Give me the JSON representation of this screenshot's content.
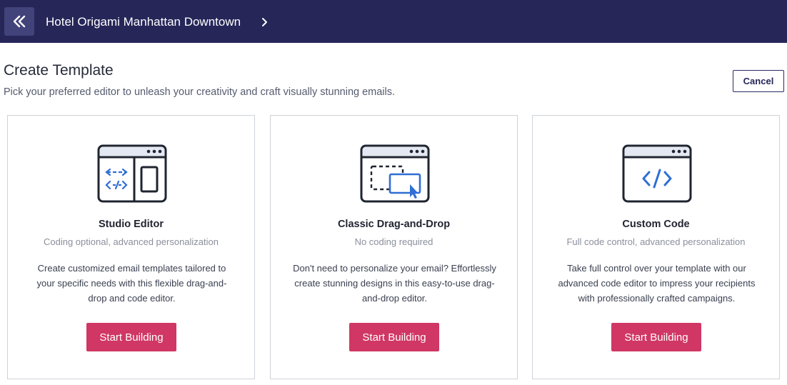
{
  "header": {
    "property_name": "Hotel Origami Manhattan Downtown"
  },
  "page": {
    "title": "Create Template",
    "subtitle": "Pick your preferred editor to unleash your creativity and craft visually stunning emails.",
    "cancel_label": "Cancel"
  },
  "colors": {
    "header_bg": "#262659",
    "accent": "#d03764",
    "icon_blue": "#2f6fd6",
    "icon_outline": "#1f2430"
  },
  "cards": [
    {
      "icon": "studio-editor-icon",
      "title": "Studio Editor",
      "subtitle": "Coding optional, advanced personalization",
      "description": "Create customized email templates tailored to your specific needs with this flexible drag-and-drop and code editor.",
      "button": "Start Building"
    },
    {
      "icon": "drag-and-drop-icon",
      "title": "Classic Drag-and-Drop",
      "subtitle": "No coding required",
      "description": "Don't need to personalize your email? Effortlessly create stunning designs in this easy-to-use drag-and-drop editor.",
      "button": "Start Building"
    },
    {
      "icon": "code-icon",
      "title": "Custom Code",
      "subtitle": "Full code control, advanced personalization",
      "description": "Take full control over your template with our advanced code editor to impress your recipients with professionally crafted campaigns.",
      "button": "Start Building"
    }
  ]
}
